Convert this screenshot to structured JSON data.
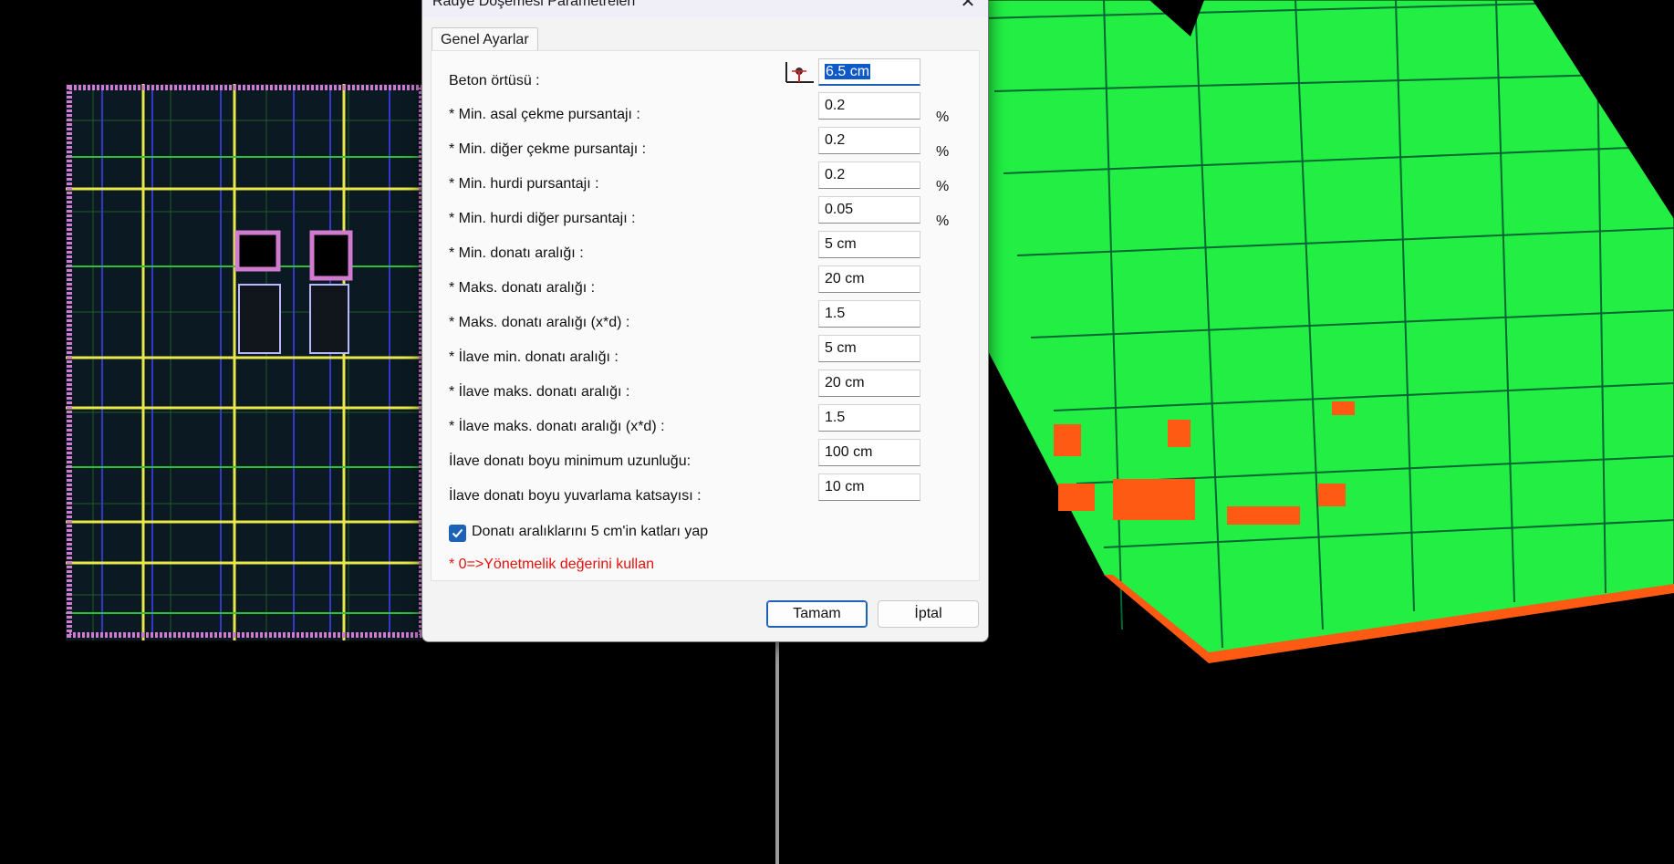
{
  "dialog": {
    "title": "Radye Döşemesi Parametreleri",
    "close_glyph": "✕",
    "tab_label": "Genel Ayarlar",
    "fields": [
      {
        "label": "Beton örtüsü :",
        "value": "6.5 cm",
        "unit": ""
      },
      {
        "label": "* Min. asal çekme pursantajı :",
        "value": "0.2",
        "unit": "%"
      },
      {
        "label": "* Min. diğer çekme pursantajı :",
        "value": "0.2",
        "unit": "%"
      },
      {
        "label": "* Min. hurdi pursantajı :",
        "value": "0.2",
        "unit": "%"
      },
      {
        "label": "* Min. hurdi diğer pursantajı :",
        "value": "0.05",
        "unit": "%"
      },
      {
        "label": "* Min. donatı aralığı :",
        "value": "5 cm",
        "unit": ""
      },
      {
        "label": "* Maks. donatı aralığı :",
        "value": "20 cm",
        "unit": ""
      },
      {
        "label": "* Maks. donatı aralığı   (x*d) :",
        "value": "1.5",
        "unit": ""
      },
      {
        "label": "* İlave min. donatı aralığı  :",
        "value": "5 cm",
        "unit": ""
      },
      {
        "label": "* İlave maks. donatı aralığı :",
        "value": "20 cm",
        "unit": ""
      },
      {
        "label": "* İlave maks. donatı aralığı  (x*d) :",
        "value": "1.5",
        "unit": ""
      },
      {
        "label": "İlave donatı boyu minimum uzunluğu:",
        "value": "100 cm",
        "unit": ""
      },
      {
        "label": "İlave donatı boyu yuvarlama katsayısı :",
        "value": "10 cm",
        "unit": ""
      }
    ],
    "checkbox": {
      "label": "Donatı aralıklarını 5 cm'in katları yap",
      "checked": true
    },
    "note": "* 0=>Yönetmelik değerini kullan",
    "ok_label": "Tamam",
    "cancel_label": "İptal"
  },
  "icons": {
    "cover": "concrete-cover-icon",
    "close": "close-icon",
    "check": "checkmark-icon"
  },
  "colors": {
    "selection": "#0e59c8",
    "note": "#e3120b",
    "plan_beam": "#e8e84a",
    "plan_wall": "#d07ad0",
    "model_slab": "#22ee44",
    "model_highlight": "#ff5a14"
  }
}
